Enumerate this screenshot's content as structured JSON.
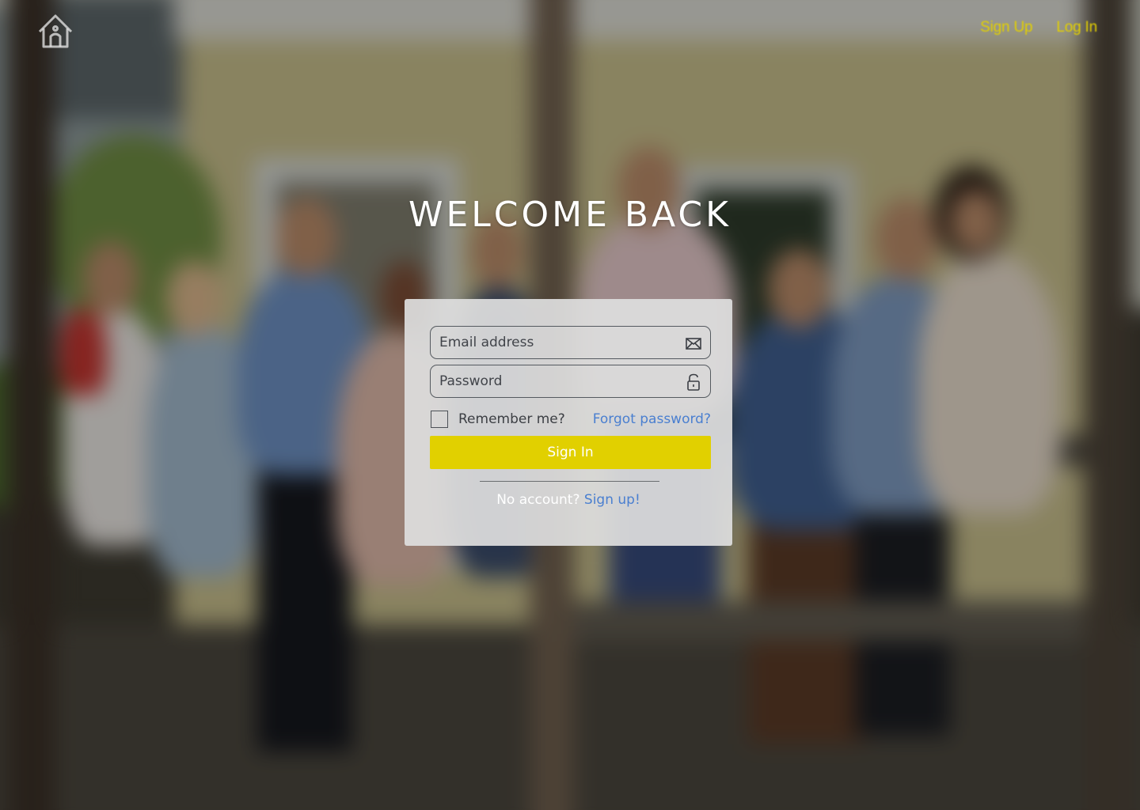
{
  "nav": {
    "home_icon": "house-icon",
    "signup_label": "Sign Up",
    "login_label": "Log In",
    "link_color": "#e3d000"
  },
  "heading": {
    "title": "WELCOME BACK"
  },
  "form": {
    "email_placeholder": "Email address",
    "email_value": "",
    "email_icon": "envelope-icon",
    "password_placeholder": "Password",
    "password_value": "",
    "password_icon": "unlocked-padlock-icon",
    "remember_label": "Remember me?",
    "remember_checked": false,
    "forgot_label": "Forgot password?",
    "signin_label": "Sign In",
    "no_account_text": "No account?",
    "signup_link_label": "Sign up!",
    "accent_color": "#e1d000",
    "link_color": "#4a7fd0"
  }
}
